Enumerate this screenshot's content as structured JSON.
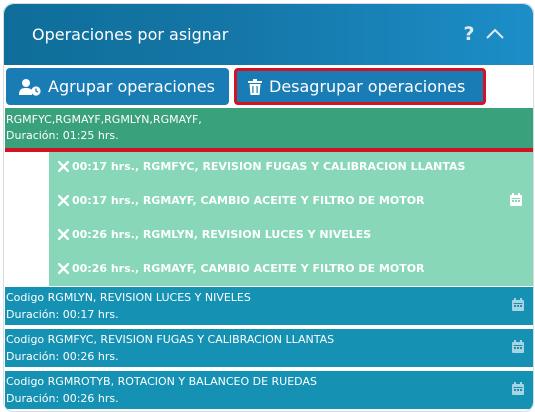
{
  "header": {
    "title": "Operaciones por asignar",
    "help": "?"
  },
  "toolbar": {
    "agrupar_label": "Agrupar operaciones",
    "desagrupar_label": "Desagrupar operaciones"
  },
  "group": {
    "codes": "RGMFYC,RGMAYF,RGMLYN,RGMAYF,",
    "duration": "Duración: 01:25 hrs.",
    "operations": [
      "00:17 hrs., RGMFYC, REVISION FUGAS Y CALIBRACION LLANTAS",
      "00:17 hrs., RGMAYF, CAMBIO ACEITE Y FILTRO DE MOTOR",
      "00:26 hrs., RGMLYN, REVISION LUCES Y NIVELES",
      "00:26 hrs., RGMAYF, CAMBIO ACEITE Y FILTRO DE MOTOR"
    ]
  },
  "rows": [
    {
      "title": "Codigo RGMLYN, REVISION LUCES Y NIVELES",
      "duration": "Duración: 00:17 hrs."
    },
    {
      "title": "Codigo RGMFYC, REVISION FUGAS Y CALIBRACION LLANTAS",
      "duration": "Duración: 00:26 hrs."
    },
    {
      "title": "Codigo RGMROTYB, ROTACION Y BALANCEO DE RUEDAS",
      "duration": "Duración: 00:26 hrs."
    }
  ],
  "colors": {
    "header": "#1577a8",
    "button": "#1a7cb5",
    "highlight": "#d31224",
    "group": "#3aa17d",
    "group_ops": "#87d7b8",
    "row": "#1592b3"
  },
  "icons": {
    "help": "question-mark-icon",
    "collapse": "chevron-up-icon",
    "agrupar": "user-clock-icon",
    "desagrupar": "trash-icon",
    "operation": "wrench-screwdriver-icon",
    "row": "calendar-icon"
  }
}
